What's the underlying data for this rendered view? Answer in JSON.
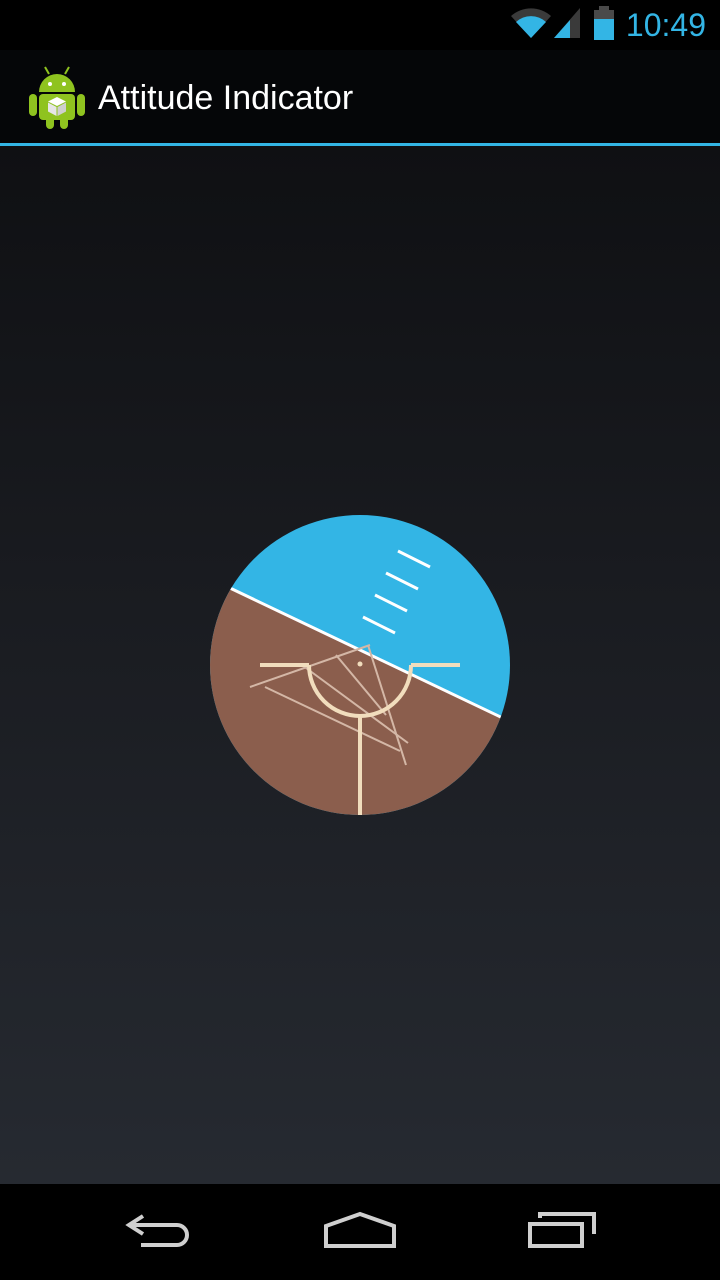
{
  "status_bar": {
    "time": "10:49",
    "icons": [
      "wifi-icon",
      "cell-signal-icon",
      "battery-icon"
    ],
    "accent_color": "#33b5e5"
  },
  "action_bar": {
    "title": "Attitude Indicator",
    "icon": "android-robot-icon",
    "divider_color": "#33b5e5"
  },
  "attitude_indicator": {
    "sky_color": "#33b5e5",
    "ground_color": "#8b5e4d",
    "marker_color": "#f1ddbd"
  },
  "navigation_bar": {
    "buttons": [
      "back-icon",
      "home-icon",
      "recent-apps-icon"
    ]
  }
}
